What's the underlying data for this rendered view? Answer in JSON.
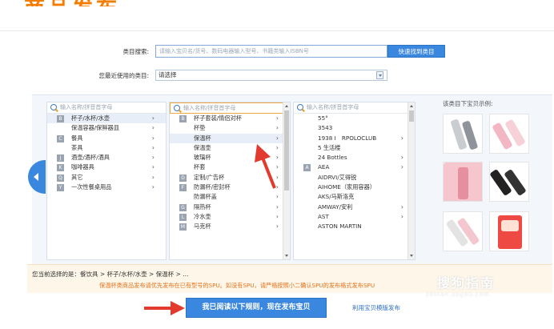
{
  "header": {
    "partial_title": "商品发布"
  },
  "search": {
    "label": "类目搜索:",
    "placeholder": "请输入宝贝名/货号、数码电器输入型号、书籍类输入ISBN号",
    "button": "快速找到类目"
  },
  "recent": {
    "label": "您最近使用的类目:",
    "value": "请选择"
  },
  "columns": [
    {
      "search_placeholder": "输入名称/拼音首字母",
      "items": [
        {
          "letter": "B",
          "label": "杯子/水杯/水壶",
          "chevron": "›",
          "selected": true
        },
        {
          "letter": "",
          "label": "保温容器/保鲜器皿",
          "chevron": "›"
        },
        {
          "letter": "C",
          "label": "餐具",
          "chevron": "›"
        },
        {
          "letter": "",
          "label": "茶具",
          "chevron": "›"
        },
        {
          "letter": "J",
          "label": "酒壶/酒杯/酒具",
          "chevron": "›"
        },
        {
          "letter": "K",
          "label": "咖啡器具",
          "chevron": "›"
        },
        {
          "letter": "Q",
          "label": "其它",
          "chevron": "›"
        },
        {
          "letter": "Y",
          "label": "一次性餐桌用品",
          "chevron": "›"
        }
      ]
    },
    {
      "search_placeholder": "输入名称/拼音首字母",
      "items": [
        {
          "letter": "B",
          "label": "杯子套装/情侣对杯",
          "chevron": "›"
        },
        {
          "letter": "",
          "label": "杯垫",
          "chevron": "›"
        },
        {
          "letter": "",
          "label": "保温杯",
          "chevron": "›",
          "selected": true
        },
        {
          "letter": "",
          "label": "保温壶",
          "chevron": "›"
        },
        {
          "letter": "",
          "label": "玻璃杯",
          "chevron": "›"
        },
        {
          "letter": "",
          "label": "杯套",
          "chevron": "›"
        },
        {
          "letter": "D",
          "label": "定制/广告杯",
          "chevron": "›"
        },
        {
          "letter": "F",
          "label": "防漏杯/密封杯",
          "chevron": "›"
        },
        {
          "letter": "",
          "label": "防漏杯盖",
          "chevron": "›"
        },
        {
          "letter": "G",
          "label": "隔热杯",
          "chevron": "›"
        },
        {
          "letter": "L",
          "label": "冷水壶",
          "chevron": "›"
        },
        {
          "letter": "M",
          "label": "马克杯",
          "chevron": "›"
        }
      ]
    },
    {
      "search_placeholder": "输入名称/拼音首字母",
      "items": [
        {
          "letter": "",
          "label": "55°",
          "chevron": ""
        },
        {
          "letter": "",
          "label": "3543",
          "chevron": ""
        },
        {
          "letter": "",
          "label": "1938 I　RPOLOCLUB",
          "chevron": "›"
        },
        {
          "letter": "",
          "label": "5 生活楼",
          "chevron": ""
        },
        {
          "letter": "",
          "label": "24 Bottles",
          "chevron": "›"
        },
        {
          "letter": "A",
          "label": "AEA",
          "chevron": "›"
        },
        {
          "letter": "",
          "label": "AIDRVI/艾得锐",
          "chevron": ""
        },
        {
          "letter": "",
          "label": "AIHOME（家用容器）",
          "chevron": ""
        },
        {
          "letter": "",
          "label": "AKS/马斯洛克",
          "chevron": ""
        },
        {
          "letter": "",
          "label": "AMWAY/安利",
          "chevron": "›"
        },
        {
          "letter": "",
          "label": "AST",
          "chevron": "›"
        },
        {
          "letter": "",
          "label": "ASTON MARTIN",
          "chevron": ""
        }
      ]
    }
  ],
  "preview": {
    "title": "该类目下宝贝示例:"
  },
  "path": {
    "text": "您当前选择的是：餐饮具 > 杯子/水杯/水壶 > 保温杯 > ...",
    "warning": "保温杯类商品发布请优先发布在已有型号的SPU。如没有SPU，请严格按照小二确认SPU的发布格式发布SPU"
  },
  "actions": {
    "publish": "我已阅读以下规则，现在发布宝贝",
    "template_link": "利用宝贝模版发布"
  },
  "watermark": {
    "main": "搜狗指南",
    "sub": "zhinan.sogou.com"
  },
  "colors": {
    "accent": "#3a87df",
    "warning": "#e5731a",
    "arrow": "#e23b2e"
  }
}
